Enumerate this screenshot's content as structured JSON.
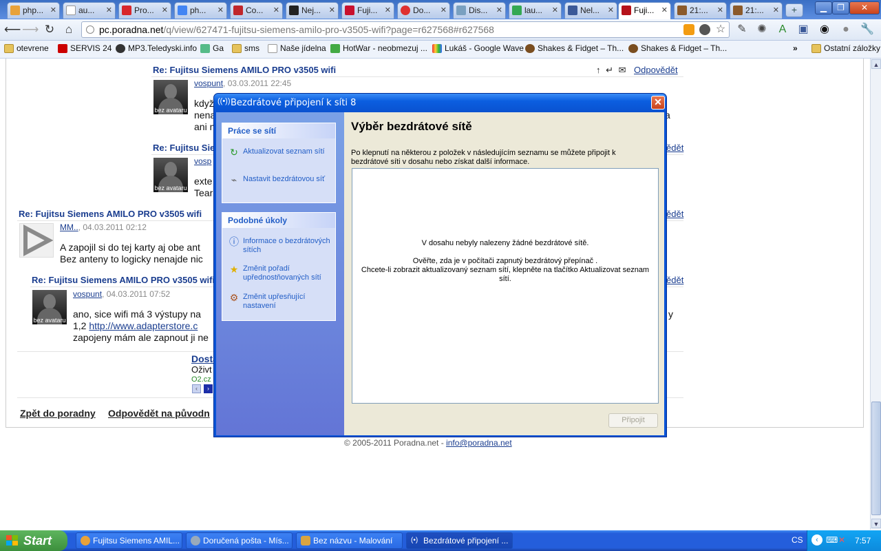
{
  "tabs": [
    {
      "label": "php...",
      "color": "#e8a23a"
    },
    {
      "label": "au...",
      "color": "#ffffff"
    },
    {
      "label": "Pro...",
      "color": "#d8262b"
    },
    {
      "label": "ph...",
      "color": "#4285f4"
    },
    {
      "label": "Co...",
      "color": "#c0262b"
    },
    {
      "label": "Nej...",
      "color": "#222222"
    },
    {
      "label": "Fuji...",
      "color": "#c8102e"
    },
    {
      "label": "Do...",
      "color": "#e03030"
    },
    {
      "label": "Dis...",
      "color": "#7aa0c0"
    },
    {
      "label": "lau...",
      "color": "#34a853"
    },
    {
      "label": "Nel...",
      "color": "#3b5998"
    },
    {
      "label": "Fuji...",
      "color": "#b5121b",
      "active": true
    },
    {
      "label": "21:...",
      "color": "#8b5a2b"
    },
    {
      "label": "21:...",
      "color": "#8b5a2b"
    }
  ],
  "toolbar": {
    "url_host": "pc.poradna.net",
    "url_path": "/q/view/627471-fujitsu-siemens-amilo-pro-v3505-wifi?page=r627568#r627568"
  },
  "bookmarks": [
    {
      "label": "otevrene",
      "icon": "folder-icon"
    },
    {
      "label": "SERVIS 24",
      "icon": "servis-icon"
    },
    {
      "label": "MP3.Teledyski.info",
      "icon": "music-icon"
    },
    {
      "label": "Ga",
      "icon": "gallery-icon"
    },
    {
      "label": "sms",
      "icon": "folder-icon"
    },
    {
      "label": "Naše jídelna",
      "icon": "page-icon"
    },
    {
      "label": "HotWar - neobmezuj ...",
      "icon": "hotwar-icon"
    },
    {
      "label": "Lukáš - Google Wave",
      "icon": "wave-icon"
    },
    {
      "label": "Shakes & Fidget – Th...",
      "icon": "game-icon"
    },
    {
      "label": "Shakes & Fidget – Th...",
      "icon": "game-icon"
    },
    {
      "label": "Ostatní záložky",
      "icon": "folder-icon"
    }
  ],
  "posts": {
    "p1": {
      "title": "Re: Fujitsu Siemens AMILO PRO v3505 wifi",
      "author": "vospunt",
      "date": ", 03.03.2011 22:45",
      "text1": "když",
      "text2": "nena",
      "text3": "ani n",
      "reply": "Odpovědět",
      "avatar_caption": "bez avataru"
    },
    "p2": {
      "title": "Re: Fujitsu Sie",
      "author": "vosp",
      "text1": "exte",
      "text2": "Tear",
      "reply": "ědět",
      "avatar_caption": "bez avataru"
    },
    "p3": {
      "title": "Re: Fujitsu Siemens AMILO PRO v3505 wifi",
      "author": "MM..",
      "date": ", 04.03.2011 02:12",
      "text1": "A zapojil si do tej karty aj obe ant",
      "text2": "Bez anteny to logicky nenajde nic",
      "reply": "ědět"
    },
    "p4": {
      "title": "Re: Fujitsu Siemens AMILO PRO v3505 wifi",
      "author": "vospunt",
      "date": ", 04.03.2011 07:52",
      "text1": "ano, sice wifi má 3 výstupy na",
      "text2_pre": "1,2 ",
      "link": "http://www.adapterstore.c",
      "text3": "zapojeny mám ale zapnout ji ne",
      "reply": "ědět",
      "tail": "y",
      "avatar_caption": "bez avataru"
    },
    "ad": {
      "title": "Dosta",
      "line1": "Oživt",
      "line2": "O2.cz"
    },
    "footer": {
      "back": "Zpět do poradny",
      "reply_orig": "Odpovědět na původn",
      "copyright": "© 2005-2011 Poradna.net - ",
      "email": "info@poradna.net"
    }
  },
  "dialog": {
    "title": "Bezdrátové připojení k síti 8",
    "left": {
      "tasks_head": "Práce se sítí",
      "refresh": "Aktualizovat seznam sítí",
      "setup": "Nastavit bezdrátovou síť",
      "related_head": "Podobné úkoly",
      "info": "Informace o bezdrátových sítích",
      "order": "Změnit pořadí upřednostňovaných sítí",
      "advanced": "Změnit upřesňující nastavení"
    },
    "heading": "Výběr bezdrátové sítě",
    "description": "Po klepnutí na některou z položek v následujícím seznamu se můžete připojit k bezdrátové síti v dosahu nebo získat další informace.",
    "empty_line1": "V dosahu nebyly nalezeny žádné bezdrátové sítě.",
    "empty_line2": "Ověřte, zda je v počítači zapnutý bezdrátový přepínač .",
    "empty_line3": "Chcete-li zobrazit aktualizovaný seznam sítí, klepněte na tlačítko Aktualizovat seznam sítí.",
    "connect": "Připojit"
  },
  "taskbar": {
    "start": "Start",
    "items": [
      {
        "label": "Fujitsu Siemens AMIL...",
        "color": "#e8a23a"
      },
      {
        "label": "Doručená pošta - Mís...",
        "color": "#9ab"
      },
      {
        "label": "Bez názvu - Malování",
        "color": "#d9a441"
      },
      {
        "label": "Bezdrátové připojení ...",
        "color": "#6cf",
        "active": true
      }
    ],
    "lang": "CS",
    "clock": "7:57"
  }
}
